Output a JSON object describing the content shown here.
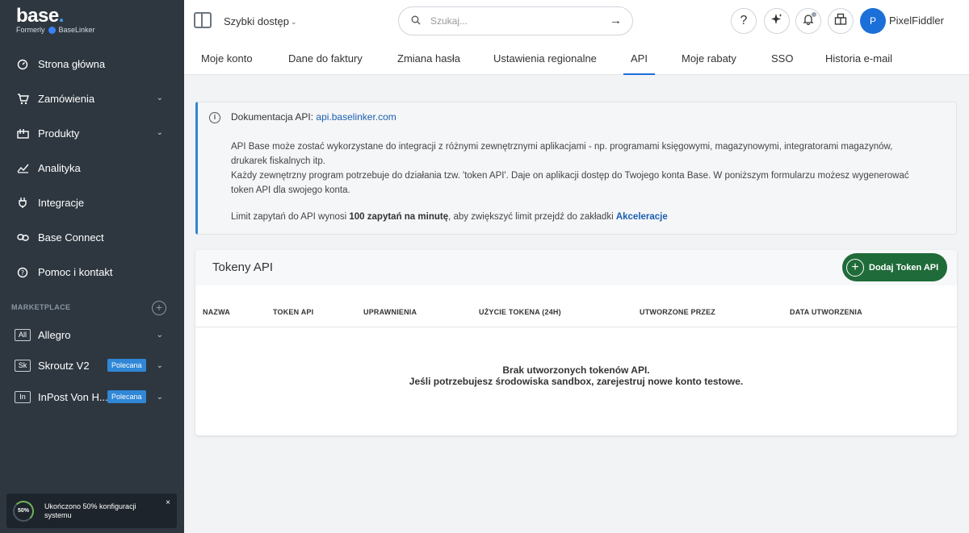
{
  "brand": {
    "name": "base",
    "formerly": "Formerly",
    "formerly_brand": "BaseLinker"
  },
  "sidebar": {
    "items": [
      {
        "label": "Strona główna",
        "icon": "dashboard-icon",
        "chevron": false
      },
      {
        "label": "Zamówienia",
        "icon": "cart-icon",
        "chevron": true
      },
      {
        "label": "Produkty",
        "icon": "products-icon",
        "chevron": true
      },
      {
        "label": "Analityka",
        "icon": "analytics-icon",
        "chevron": false
      },
      {
        "label": "Integracje",
        "icon": "plug-icon",
        "chevron": false
      },
      {
        "label": "Base Connect",
        "icon": "link-icon",
        "chevron": false
      },
      {
        "label": "Pomoc i kontakt",
        "icon": "help-icon",
        "chevron": false
      }
    ],
    "marketplace_header": "MARKETPLACE",
    "marketplace": [
      {
        "abbr": "All",
        "label": "Allegro",
        "badge": ""
      },
      {
        "abbr": "Sk",
        "label": "Skroutz V2",
        "badge": "Polecana"
      },
      {
        "abbr": "In",
        "label": "InPost Von H...",
        "badge": "Polecana"
      }
    ],
    "setup": {
      "percent": "50%",
      "text": "Ukończono 50% konfiguracji systemu",
      "close": "×"
    }
  },
  "topbar": {
    "quick_access": "Szybki dostęp",
    "search_placeholder": "Szukaj...",
    "user_initial": "P",
    "username": "PixelFiddler"
  },
  "tabs": [
    {
      "label": "Moje konto",
      "active": false
    },
    {
      "label": "Dane do faktury",
      "active": false
    },
    {
      "label": "Zmiana hasła",
      "active": false
    },
    {
      "label": "Ustawienia regionalne",
      "active": false
    },
    {
      "label": "API",
      "active": true
    },
    {
      "label": "Moje rabaty",
      "active": false
    },
    {
      "label": "SSO",
      "active": false
    },
    {
      "label": "Historia e-mail",
      "active": false
    }
  ],
  "info": {
    "title_prefix": "Dokumentacja API:",
    "title_link": "api.baselinker.com",
    "p1": "API Base może zostać wykorzystane do integracji z różnymi zewnętrznymi aplikacjami - np. programami księgowymi, magazynowymi, integratorami magazynów, drukarek fiskalnych itp.",
    "p2": "Każdy zewnętrzny program potrzebuje do działania tzw. 'token API'. Daje on aplikacji dostęp do Twojego konta Base. W poniższym formularzu możesz wygenerować token API dla swojego konta.",
    "limit_prefix": "Limit zapytań do API wynosi",
    "limit_value": "100 zapytań na minutę",
    "limit_middle": ", aby zwiększyć limit przejdź do zakładki",
    "limit_link": "Akceleracje"
  },
  "tokens": {
    "title": "Tokeny API",
    "add_button": "Dodaj Token API",
    "columns": [
      "NAZWA",
      "TOKEN API",
      "UPRAWNIENIA",
      "UŻYCIE TOKENA (24H)",
      "UTWORZONE PRZEZ",
      "DATA UTWORZENIA"
    ],
    "empty_line1": "Brak utworzonych tokenów API.",
    "empty_line2": "Jeśli potrzebujesz środowiska sandbox, zarejestruj nowe konto testowe."
  }
}
